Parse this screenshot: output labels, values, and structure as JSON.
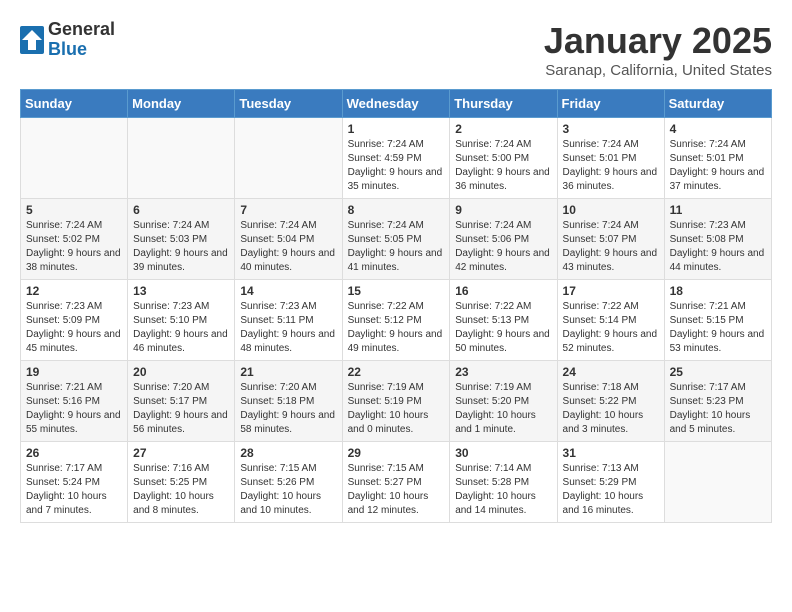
{
  "header": {
    "logo_general": "General",
    "logo_blue": "Blue",
    "month_title": "January 2025",
    "location": "Saranap, California, United States"
  },
  "weekdays": [
    "Sunday",
    "Monday",
    "Tuesday",
    "Wednesday",
    "Thursday",
    "Friday",
    "Saturday"
  ],
  "weeks": [
    [
      {
        "day": "",
        "info": ""
      },
      {
        "day": "",
        "info": ""
      },
      {
        "day": "",
        "info": ""
      },
      {
        "day": "1",
        "info": "Sunrise: 7:24 AM\nSunset: 4:59 PM\nDaylight: 9 hours and 35 minutes."
      },
      {
        "day": "2",
        "info": "Sunrise: 7:24 AM\nSunset: 5:00 PM\nDaylight: 9 hours and 36 minutes."
      },
      {
        "day": "3",
        "info": "Sunrise: 7:24 AM\nSunset: 5:01 PM\nDaylight: 9 hours and 36 minutes."
      },
      {
        "day": "4",
        "info": "Sunrise: 7:24 AM\nSunset: 5:01 PM\nDaylight: 9 hours and 37 minutes."
      }
    ],
    [
      {
        "day": "5",
        "info": "Sunrise: 7:24 AM\nSunset: 5:02 PM\nDaylight: 9 hours and 38 minutes."
      },
      {
        "day": "6",
        "info": "Sunrise: 7:24 AM\nSunset: 5:03 PM\nDaylight: 9 hours and 39 minutes."
      },
      {
        "day": "7",
        "info": "Sunrise: 7:24 AM\nSunset: 5:04 PM\nDaylight: 9 hours and 40 minutes."
      },
      {
        "day": "8",
        "info": "Sunrise: 7:24 AM\nSunset: 5:05 PM\nDaylight: 9 hours and 41 minutes."
      },
      {
        "day": "9",
        "info": "Sunrise: 7:24 AM\nSunset: 5:06 PM\nDaylight: 9 hours and 42 minutes."
      },
      {
        "day": "10",
        "info": "Sunrise: 7:24 AM\nSunset: 5:07 PM\nDaylight: 9 hours and 43 minutes."
      },
      {
        "day": "11",
        "info": "Sunrise: 7:23 AM\nSunset: 5:08 PM\nDaylight: 9 hours and 44 minutes."
      }
    ],
    [
      {
        "day": "12",
        "info": "Sunrise: 7:23 AM\nSunset: 5:09 PM\nDaylight: 9 hours and 45 minutes."
      },
      {
        "day": "13",
        "info": "Sunrise: 7:23 AM\nSunset: 5:10 PM\nDaylight: 9 hours and 46 minutes."
      },
      {
        "day": "14",
        "info": "Sunrise: 7:23 AM\nSunset: 5:11 PM\nDaylight: 9 hours and 48 minutes."
      },
      {
        "day": "15",
        "info": "Sunrise: 7:22 AM\nSunset: 5:12 PM\nDaylight: 9 hours and 49 minutes."
      },
      {
        "day": "16",
        "info": "Sunrise: 7:22 AM\nSunset: 5:13 PM\nDaylight: 9 hours and 50 minutes."
      },
      {
        "day": "17",
        "info": "Sunrise: 7:22 AM\nSunset: 5:14 PM\nDaylight: 9 hours and 52 minutes."
      },
      {
        "day": "18",
        "info": "Sunrise: 7:21 AM\nSunset: 5:15 PM\nDaylight: 9 hours and 53 minutes."
      }
    ],
    [
      {
        "day": "19",
        "info": "Sunrise: 7:21 AM\nSunset: 5:16 PM\nDaylight: 9 hours and 55 minutes."
      },
      {
        "day": "20",
        "info": "Sunrise: 7:20 AM\nSunset: 5:17 PM\nDaylight: 9 hours and 56 minutes."
      },
      {
        "day": "21",
        "info": "Sunrise: 7:20 AM\nSunset: 5:18 PM\nDaylight: 9 hours and 58 minutes."
      },
      {
        "day": "22",
        "info": "Sunrise: 7:19 AM\nSunset: 5:19 PM\nDaylight: 10 hours and 0 minutes."
      },
      {
        "day": "23",
        "info": "Sunrise: 7:19 AM\nSunset: 5:20 PM\nDaylight: 10 hours and 1 minute."
      },
      {
        "day": "24",
        "info": "Sunrise: 7:18 AM\nSunset: 5:22 PM\nDaylight: 10 hours and 3 minutes."
      },
      {
        "day": "25",
        "info": "Sunrise: 7:17 AM\nSunset: 5:23 PM\nDaylight: 10 hours and 5 minutes."
      }
    ],
    [
      {
        "day": "26",
        "info": "Sunrise: 7:17 AM\nSunset: 5:24 PM\nDaylight: 10 hours and 7 minutes."
      },
      {
        "day": "27",
        "info": "Sunrise: 7:16 AM\nSunset: 5:25 PM\nDaylight: 10 hours and 8 minutes."
      },
      {
        "day": "28",
        "info": "Sunrise: 7:15 AM\nSunset: 5:26 PM\nDaylight: 10 hours and 10 minutes."
      },
      {
        "day": "29",
        "info": "Sunrise: 7:15 AM\nSunset: 5:27 PM\nDaylight: 10 hours and 12 minutes."
      },
      {
        "day": "30",
        "info": "Sunrise: 7:14 AM\nSunset: 5:28 PM\nDaylight: 10 hours and 14 minutes."
      },
      {
        "day": "31",
        "info": "Sunrise: 7:13 AM\nSunset: 5:29 PM\nDaylight: 10 hours and 16 minutes."
      },
      {
        "day": "",
        "info": ""
      }
    ]
  ]
}
